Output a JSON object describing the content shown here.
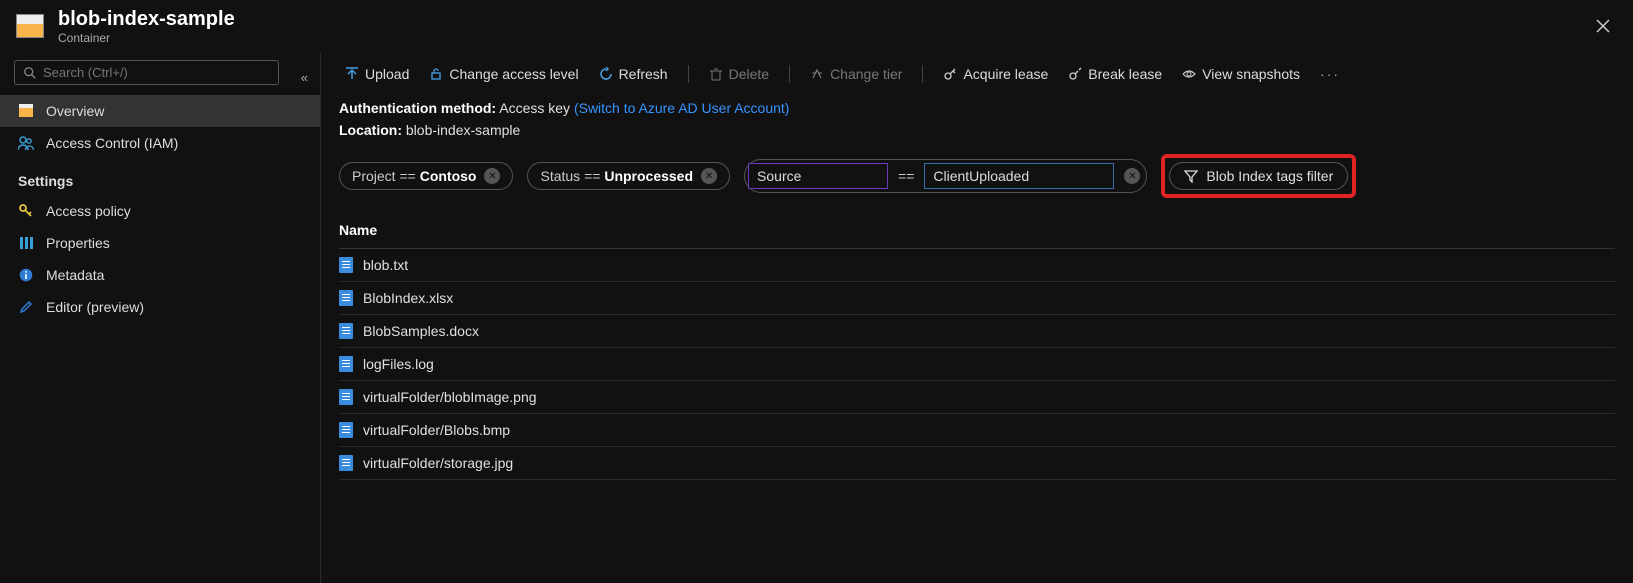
{
  "header": {
    "title": "blob-index-sample",
    "subtitle": "Container"
  },
  "sidebar": {
    "search_placeholder": "Search (Ctrl+/)",
    "items": [
      {
        "label": "Overview",
        "icon": "overview"
      },
      {
        "label": "Access Control (IAM)",
        "icon": "access-control"
      }
    ],
    "settings_header": "Settings",
    "settings": [
      {
        "label": "Access policy",
        "icon": "key"
      },
      {
        "label": "Properties",
        "icon": "properties"
      },
      {
        "label": "Metadata",
        "icon": "info"
      },
      {
        "label": "Editor (preview)",
        "icon": "pencil"
      }
    ]
  },
  "toolbar": {
    "upload": "Upload",
    "change_access": "Change access level",
    "refresh": "Refresh",
    "delete": "Delete",
    "change_tier": "Change tier",
    "acquire_lease": "Acquire lease",
    "break_lease": "Break lease",
    "view_snapshots": "View snapshots"
  },
  "meta": {
    "auth_label": "Authentication method:",
    "auth_value": "Access key",
    "auth_link": "(Switch to Azure AD User Account)",
    "location_label": "Location:",
    "location_value": "blob-index-sample"
  },
  "filters": {
    "pills": [
      {
        "key": "Project",
        "op": "==",
        "value": "Contoso"
      },
      {
        "key": "Status",
        "op": "==",
        "value": "Unprocessed"
      }
    ],
    "kv_key": "Source",
    "kv_op": "==",
    "kv_value": "ClientUploaded",
    "filter_button": "Blob Index tags filter"
  },
  "table": {
    "header": "Name",
    "rows": [
      "blob.txt",
      "BlobIndex.xlsx",
      "BlobSamples.docx",
      "logFiles.log",
      "virtualFolder/blobImage.png",
      "virtualFolder/Blobs.bmp",
      "virtualFolder/storage.jpg"
    ]
  }
}
